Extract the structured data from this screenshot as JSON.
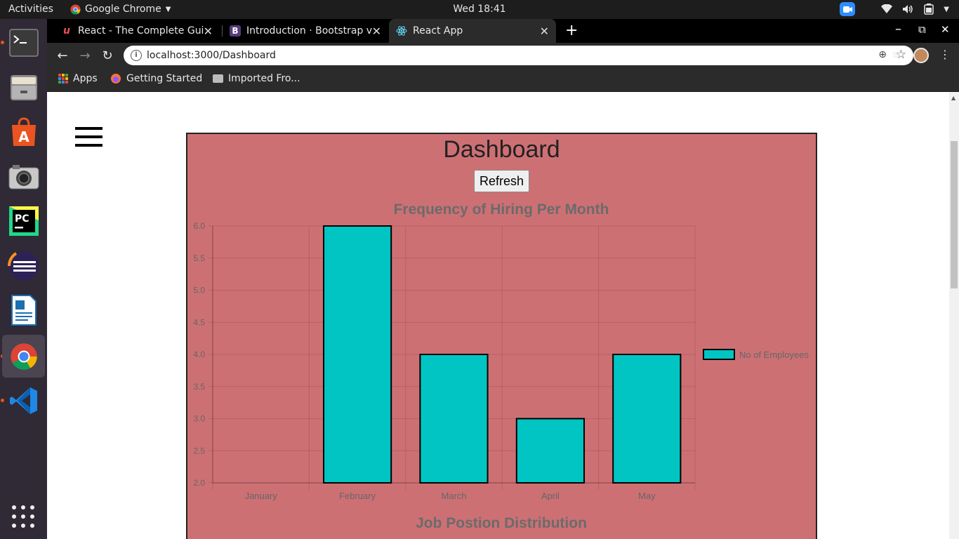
{
  "os": {
    "activities": "Activities",
    "app_menu": "Google Chrome",
    "clock": "Wed 18:41"
  },
  "dock": {
    "items": [
      "terminal-icon",
      "files-icon",
      "software-center-icon",
      "camera-icon",
      "pycharm-icon",
      "eclipse-icon",
      "writer-icon",
      "chrome-icon",
      "vscode-icon"
    ],
    "show_apps": "show-applications-icon"
  },
  "browser": {
    "tabs": [
      {
        "title": "React - The Complete Guide",
        "favicon": "udemy-icon",
        "active": false
      },
      {
        "title": "Introduction · Bootstrap v",
        "favicon": "bootstrap-icon",
        "active": false
      },
      {
        "title": "React App",
        "favicon": "react-icon",
        "active": true
      }
    ],
    "url": "localhost:3000/Dashboard",
    "bookmarks": [
      "Apps",
      "Getting Started",
      "Imported Fro..."
    ]
  },
  "page": {
    "title": "Dashboard",
    "refresh_label": "Refresh",
    "second_chart_title": "Job Postion Distribution"
  },
  "chart_data": {
    "type": "bar",
    "title": "Frequency of Hiring Per Month",
    "categories": [
      "January",
      "February",
      "March",
      "April",
      "May"
    ],
    "series": [
      {
        "name": "No of Employees",
        "values": [
          2,
          6,
          4,
          3,
          4
        ],
        "color": "#00c5c2"
      }
    ],
    "ylim": [
      2,
      6
    ],
    "yticks": [
      "2.0",
      "2.5",
      "3.0",
      "3.5",
      "4.0",
      "4.5",
      "5.0",
      "5.5",
      "6.0"
    ],
    "grid": true,
    "legend_position": "right"
  },
  "colors": {
    "panel_bg": "#cd7074",
    "bar_fill": "#00c5c2",
    "text_muted": "#666666"
  }
}
